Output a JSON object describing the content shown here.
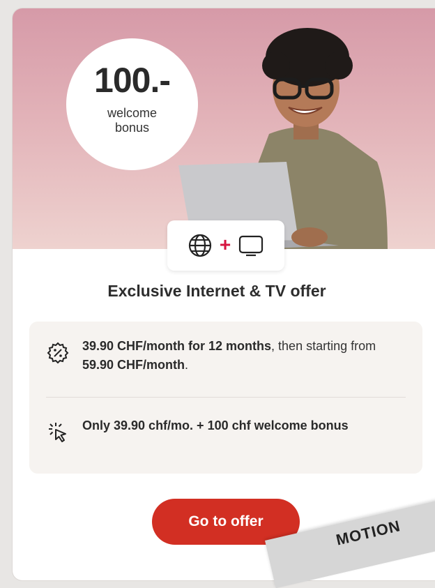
{
  "offer": {
    "bonus_amount": "100.-",
    "bonus_label": "welcome bonus",
    "title": "Exclusive Internet & TV offer",
    "features": [
      {
        "icon": "percent-icon",
        "bold_1": "39.90 CHF/month for 12 months",
        "text_1": ", then starting from ",
        "bold_2": "59.90 CHF/month",
        "text_2": "."
      },
      {
        "icon": "click-icon",
        "bold_1": "Only 39.90 chf/mo. + 100 chf welcome bonus"
      }
    ],
    "cta_label": "Go to offer",
    "promo_label": "MOTION",
    "icons": [
      "globe-icon",
      "tv-icon"
    ],
    "colors": {
      "accent": "#d22f23",
      "plus": "#d6143f",
      "panel": "#f6f3f0",
      "hero_top": "#d69aa8"
    }
  }
}
